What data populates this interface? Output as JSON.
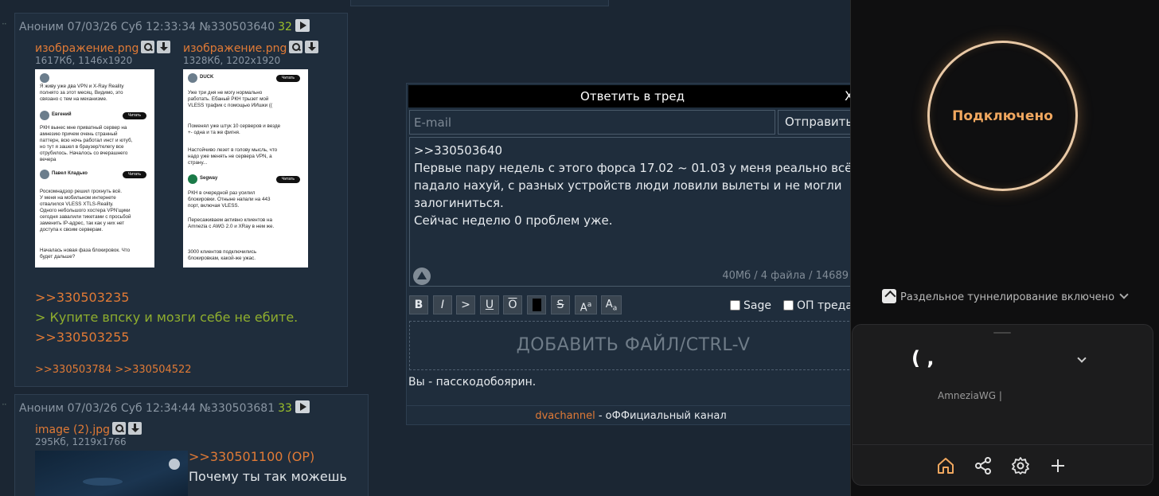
{
  "posts": [
    {
      "author": "Аноним",
      "date": "07/03/26 Суб 12:33:34",
      "number": "№330503640",
      "replies_count": "32",
      "files": [
        {
          "name": "изображение.png",
          "meta": "1617Кб, 1146x1920"
        },
        {
          "name": "изображение.png",
          "meta": "1328Кб, 1202x1920"
        }
      ],
      "thumb1_lines": [
        "Я живу уже два VPN и X-Ray Reality",
        "полнято за этот месяц. Видимо, это",
        "связано с тем на механизме.",
        "РКН вынес мне приватный сервер на",
        "амнезию причем очень странный",
        "паттерн, всю ночь работал инст и ютуб,",
        "но тут я зашел в браузер/телегу все",
        "отрубилось. Началось со вчерашнего",
        "вечера",
        "Роскомнадзор решил грохнуть всё.",
        "У меня на мобильном интернете",
        "отвалился VLESS XTLS-Reality.",
        "Одного небольшого хостера VPN'щики",
        "сегодня завалили тикетами с просьбой",
        "заменить IP-адрес, так как у них нет",
        "доступа к своим серверам.",
        "Началась новая фаза блокировок. Что",
        "будет дальше?"
      ],
      "thumb1_names": [
        "Евгений",
        "Павел Кладько"
      ],
      "thumb2_lines": [
        "Уже три дня не могу нормально",
        "работать. Ебаный РКН трызет мой",
        "VLESS трафик с помощью ИИшки ((",
        "Поменял уже штук 10 серверов и везде",
        "+- одна и та же фигня.",
        "Настойчиво лезет в голову мысль, что",
        "надо уже менять не сервера VPN, а",
        "страну...",
        "РКН в очередной раз усилил",
        "блокировки. Отныне напали на 443",
        "порт, включая VLESS.",
        "Пересаживаем активно клиентов на",
        "Amnezia с AWG 2.0 и XRay в нем же.",
        "3000 клиентов подключились",
        "блокировкам, какой-же ужас."
      ],
      "thumb2_names": [
        "DUCK",
        "Segway"
      ],
      "thumb_button": "Читать",
      "quote1": ">>330503235",
      "greentext": "> Купите впску и мозги себе не ебите.",
      "quote2": ">>330503255",
      "backlinks": ">>330503784 >>330504522"
    },
    {
      "author": "Аноним",
      "date": "07/03/26 Суб 12:34:44",
      "number": "№330503681",
      "replies_count": "33",
      "file": {
        "name": "image (2).jpg",
        "meta": "295Кб, 1219x1766"
      },
      "quote": ">>330501100 (OP)",
      "text": "Почему ты так можешь"
    }
  ],
  "reply_form": {
    "title": "Ответить в тред",
    "close": "X",
    "email_placeholder": "E-mail",
    "send_label": "Отправить",
    "message": ">>330503640\nПервые пару недель с этого форса 17.02 ~ 01.03 у меня реально всё\nпадало нахуй, с разных устройств люди ловили вылеты и не могли\nзалогиниться.\nСейчас неделю 0 проблем уже.",
    "counter": "40Мб / 4 файла / 14689",
    "format_buttons": [
      "B",
      "I",
      ">",
      "U",
      "O",
      "S"
    ],
    "sage_label": "Sage",
    "op_label": "ОП треда",
    "dropzone": "ДОБАВИТЬ ФАЙЛ/CTRL-V",
    "captcha_text": "Вы - пасскодобоярин.",
    "footer_link": "dvachannel",
    "footer_text": " - оФФициальный канал"
  },
  "vpn": {
    "status": "Подключено",
    "split_tunneling": "Раздельное туннелирование включено",
    "server_name": "(                       ,",
    "protocol": "AmneziaWG |",
    "accent": "#f0a75f"
  }
}
